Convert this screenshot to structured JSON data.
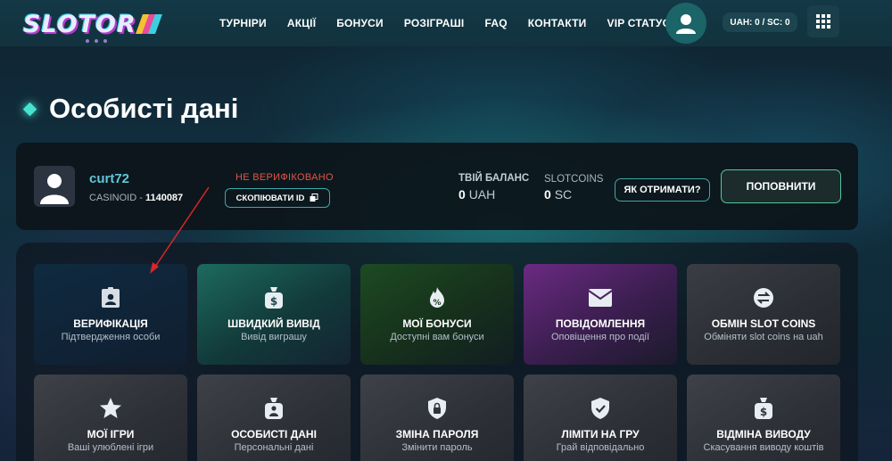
{
  "logo": {
    "text": "SLOTOR"
  },
  "nav": {
    "items": [
      "ТУРНІРИ",
      "АКЦІЇ",
      "БОНУСИ",
      "РОЗІГРАШІ",
      "FAQ",
      "КОНТАКТИ",
      "VIP СТАТУС"
    ]
  },
  "header": {
    "balance": "UAH: 0 / SC: 0"
  },
  "page": {
    "title": "Особисті дані"
  },
  "profile": {
    "username": "curt72",
    "casinoid_label": "CASINOID - ",
    "casinoid_value": "1140087",
    "status": "НЕ ВЕРИФІКОВАНО",
    "copy_id": "СКОПІЮВАТИ ID",
    "balance_label": "ТВІЙ БАЛАНС",
    "balance_amount": "0",
    "balance_currency": "UAH",
    "slotcoins_label": "SLOTCOINS",
    "slotcoins_amount": "0",
    "slotcoins_currency": "SC",
    "how_to_get": "ЯК ОТРИМАТИ?",
    "top_up": "ПОПОВНИТИ"
  },
  "tiles": [
    {
      "title": "ВЕРИФІКАЦІЯ",
      "subtitle": "Підтвердження особи",
      "icon": "id-badge-icon"
    },
    {
      "title": "ШВИДКИЙ ВИВІД",
      "subtitle": "Вивід виграшу",
      "icon": "money-bag-icon"
    },
    {
      "title": "МОЇ БОНУСИ",
      "subtitle": "Доступні вам бонуси",
      "icon": "bonus-fire-icon"
    },
    {
      "title": "ПОВІДОМЛЕННЯ",
      "subtitle": "Оповіщення про події",
      "icon": "envelope-icon"
    },
    {
      "title": "ОБМІН SLOT COINS",
      "subtitle": "Обміняти slot coins на uah",
      "icon": "exchange-icon"
    },
    {
      "title": "МОЇ ІГРИ",
      "subtitle": "Ваші улюблені ігри",
      "icon": "star-icon"
    },
    {
      "title": "ОСОБИСТІ ДАНІ",
      "subtitle": "Персональні дані",
      "icon": "personal-info-icon"
    },
    {
      "title": "ЗМІНА ПАРОЛЯ",
      "subtitle": "Змінити пароль",
      "icon": "shield-lock-icon"
    },
    {
      "title": "ЛІМІТИ НА ГРУ",
      "subtitle": "Грай відповідально",
      "icon": "shield-check-icon"
    },
    {
      "title": "ВІДМІНА ВИВОДУ",
      "subtitle": "Скасування виводу коштів",
      "icon": "money-bag-cancel-icon"
    }
  ],
  "colors": {
    "accent": "#46e3d0",
    "username": "#5fc7d8",
    "not_verified": "#e55345",
    "annotation_arrow": "#d8262a"
  }
}
